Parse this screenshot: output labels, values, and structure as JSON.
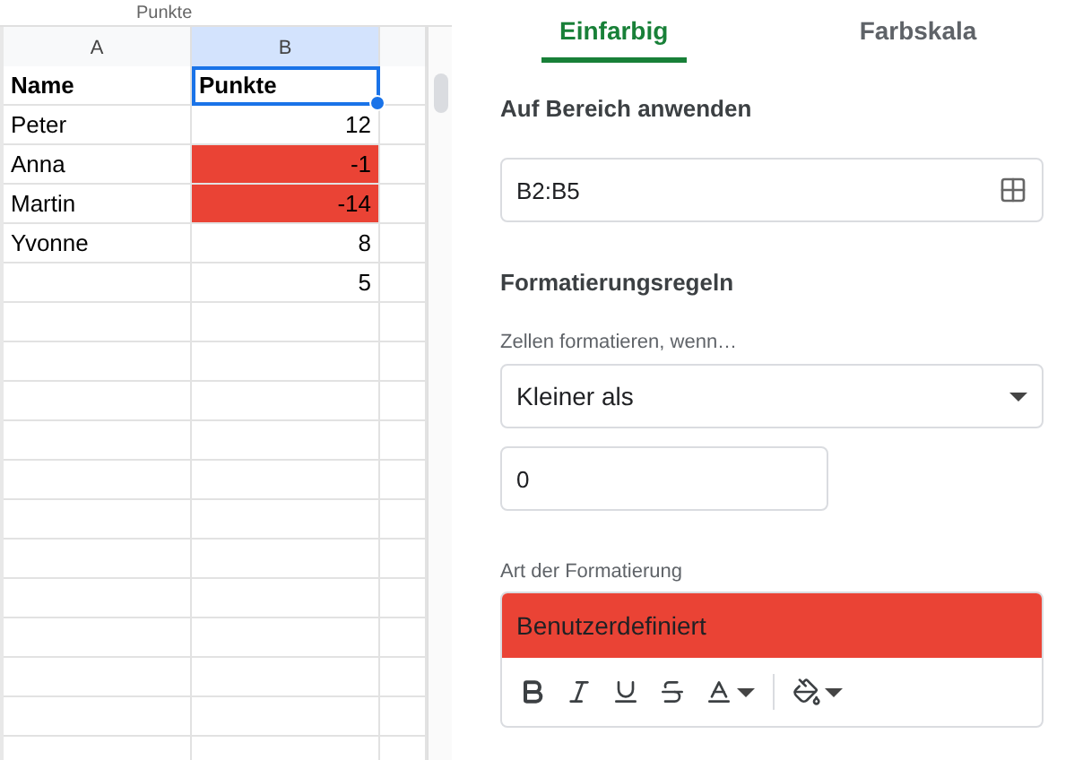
{
  "formula_bar": {
    "value": "Punkte"
  },
  "sheet": {
    "columns": [
      {
        "label": "A",
        "selected": false
      },
      {
        "label": "B",
        "selected": true
      }
    ],
    "rows": [
      {
        "name": {
          "text": "Name",
          "bold": true
        },
        "points": {
          "text": "Punkte",
          "bold": true,
          "kind": "text",
          "highlighted": false,
          "selected": true
        }
      },
      {
        "name": {
          "text": "Peter",
          "bold": false
        },
        "points": {
          "text": "12",
          "bold": false,
          "kind": "number",
          "highlighted": false,
          "selected": false
        }
      },
      {
        "name": {
          "text": "Anna",
          "bold": false
        },
        "points": {
          "text": "-1",
          "bold": false,
          "kind": "number",
          "highlighted": true,
          "selected": false
        }
      },
      {
        "name": {
          "text": "Martin",
          "bold": false
        },
        "points": {
          "text": "-14",
          "bold": false,
          "kind": "number",
          "highlighted": true,
          "selected": false
        }
      },
      {
        "name": {
          "text": "Yvonne",
          "bold": false
        },
        "points": {
          "text": "8",
          "bold": false,
          "kind": "number",
          "highlighted": false,
          "selected": false
        }
      },
      {
        "points": {
          "text": "5",
          "bold": false,
          "kind": "number",
          "highlighted": false,
          "selected": false
        }
      }
    ]
  },
  "panel": {
    "tabs": [
      {
        "label": "Einfarbig",
        "selected": true
      },
      {
        "label": "Farbskala",
        "selected": false
      }
    ],
    "range_label": "Auf Bereich anwenden",
    "range_value": "B2:B5",
    "rules_heading": "Formatierungsregeln",
    "condition_label": "Zellen formatieren, wenn…",
    "condition": "Kleiner als",
    "condition_value": "0",
    "style_label": "Art der Formatierung",
    "style_preview": "Benutzerdefiniert",
    "toolbar": [
      {
        "kind": "bold"
      },
      {
        "kind": "italic"
      },
      {
        "kind": "underline"
      },
      {
        "kind": "strike"
      },
      {
        "kind": "textcolor"
      },
      {
        "kind": "divider"
      },
      {
        "kind": "fill"
      }
    ]
  }
}
